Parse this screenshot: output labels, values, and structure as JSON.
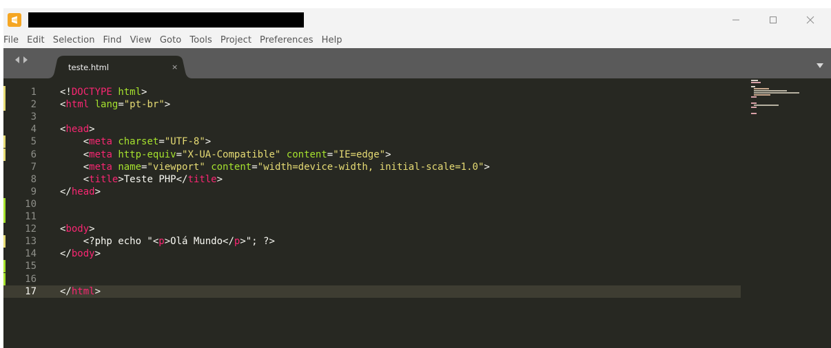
{
  "window": {
    "title_redacted": true,
    "accent": "#f5a623"
  },
  "menu": [
    "File",
    "Edit",
    "Selection",
    "Find",
    "View",
    "Goto",
    "Tools",
    "Project",
    "Preferences",
    "Help"
  ],
  "tabs": [
    {
      "label": "teste.html",
      "close_glyph": "×",
      "active": true
    }
  ],
  "editor": {
    "theme_bg": "#272822",
    "current_line": 17,
    "gutter_marks": [
      {
        "line": 1,
        "color": "#e6db74"
      },
      {
        "line": 2,
        "color": "#e6db74"
      },
      {
        "line": 5,
        "color": "#e6db74"
      },
      {
        "line": 6,
        "color": "#e6db74"
      },
      {
        "line": 10,
        "color": "#a6e22e"
      },
      {
        "line": 11,
        "color": "#a6e22e"
      },
      {
        "line": 13,
        "color": "#e6db74"
      },
      {
        "line": 15,
        "color": "#a6e22e"
      },
      {
        "line": 16,
        "color": "#a6e22e"
      }
    ],
    "lines": [
      {
        "n": "1",
        "tokens": [
          {
            "t": "<!",
            "c": "plain"
          },
          {
            "t": "DOCTYPE",
            "c": "tn"
          },
          {
            "t": " ",
            "c": "plain"
          },
          {
            "t": "html",
            "c": "attr"
          },
          {
            "t": ">",
            "c": "plain"
          }
        ]
      },
      {
        "n": "2",
        "tokens": [
          {
            "t": "<",
            "c": "plain"
          },
          {
            "t": "html",
            "c": "tn"
          },
          {
            "t": " ",
            "c": "plain"
          },
          {
            "t": "lang",
            "c": "attr"
          },
          {
            "t": "=",
            "c": "plain"
          },
          {
            "t": "\"pt-br\"",
            "c": "str"
          },
          {
            "t": ">",
            "c": "plain"
          }
        ]
      },
      {
        "n": "3",
        "tokens": []
      },
      {
        "n": "4",
        "tokens": [
          {
            "t": "<",
            "c": "plain"
          },
          {
            "t": "head",
            "c": "tn"
          },
          {
            "t": ">",
            "c": "plain"
          }
        ]
      },
      {
        "n": "5",
        "tokens": [
          {
            "t": "    <",
            "c": "plain"
          },
          {
            "t": "meta",
            "c": "tn"
          },
          {
            "t": " ",
            "c": "plain"
          },
          {
            "t": "charset",
            "c": "attr"
          },
          {
            "t": "=",
            "c": "plain"
          },
          {
            "t": "\"UTF-8\"",
            "c": "str"
          },
          {
            "t": ">",
            "c": "plain"
          }
        ]
      },
      {
        "n": "6",
        "tokens": [
          {
            "t": "    <",
            "c": "plain"
          },
          {
            "t": "meta",
            "c": "tn"
          },
          {
            "t": " ",
            "c": "plain"
          },
          {
            "t": "http-equiv",
            "c": "attr"
          },
          {
            "t": "=",
            "c": "plain"
          },
          {
            "t": "\"X-UA-Compatible\"",
            "c": "str"
          },
          {
            "t": " ",
            "c": "plain"
          },
          {
            "t": "content",
            "c": "attr"
          },
          {
            "t": "=",
            "c": "plain"
          },
          {
            "t": "\"IE=edge\"",
            "c": "str"
          },
          {
            "t": ">",
            "c": "plain"
          }
        ]
      },
      {
        "n": "7",
        "tokens": [
          {
            "t": "    <",
            "c": "plain"
          },
          {
            "t": "meta",
            "c": "tn"
          },
          {
            "t": " ",
            "c": "plain"
          },
          {
            "t": "name",
            "c": "attr"
          },
          {
            "t": "=",
            "c": "plain"
          },
          {
            "t": "\"viewport\"",
            "c": "str"
          },
          {
            "t": " ",
            "c": "plain"
          },
          {
            "t": "content",
            "c": "attr"
          },
          {
            "t": "=",
            "c": "plain"
          },
          {
            "t": "\"width=device-width, initial-scale=1.0\"",
            "c": "str"
          },
          {
            "t": ">",
            "c": "plain"
          }
        ]
      },
      {
        "n": "8",
        "tokens": [
          {
            "t": "    <",
            "c": "plain"
          },
          {
            "t": "title",
            "c": "tn"
          },
          {
            "t": ">Teste PHP</",
            "c": "plain"
          },
          {
            "t": "title",
            "c": "tn"
          },
          {
            "t": ">",
            "c": "plain"
          }
        ]
      },
      {
        "n": "9",
        "tokens": [
          {
            "t": "</",
            "c": "plain"
          },
          {
            "t": "head",
            "c": "tn"
          },
          {
            "t": ">",
            "c": "plain"
          }
        ]
      },
      {
        "n": "10",
        "tokens": []
      },
      {
        "n": "11",
        "tokens": []
      },
      {
        "n": "12",
        "tokens": [
          {
            "t": "<",
            "c": "plain"
          },
          {
            "t": "body",
            "c": "tn"
          },
          {
            "t": ">",
            "c": "plain"
          }
        ]
      },
      {
        "n": "13",
        "tokens": [
          {
            "t": "    <?php echo \"<",
            "c": "plain"
          },
          {
            "t": "p",
            "c": "tn"
          },
          {
            "t": ">Olá Mundo</",
            "c": "plain"
          },
          {
            "t": "p",
            "c": "tn"
          },
          {
            "t": ">\"; ?>",
            "c": "plain"
          }
        ]
      },
      {
        "n": "14",
        "tokens": [
          {
            "t": "</",
            "c": "plain"
          },
          {
            "t": "body",
            "c": "tn"
          },
          {
            "t": ">",
            "c": "plain"
          }
        ]
      },
      {
        "n": "15",
        "tokens": []
      },
      {
        "n": "16",
        "tokens": []
      },
      {
        "n": "17",
        "tokens": [
          {
            "t": "</",
            "c": "plain"
          },
          {
            "t": "html",
            "c": "tn"
          },
          {
            "t": ">",
            "c": "plain"
          }
        ]
      }
    ]
  }
}
